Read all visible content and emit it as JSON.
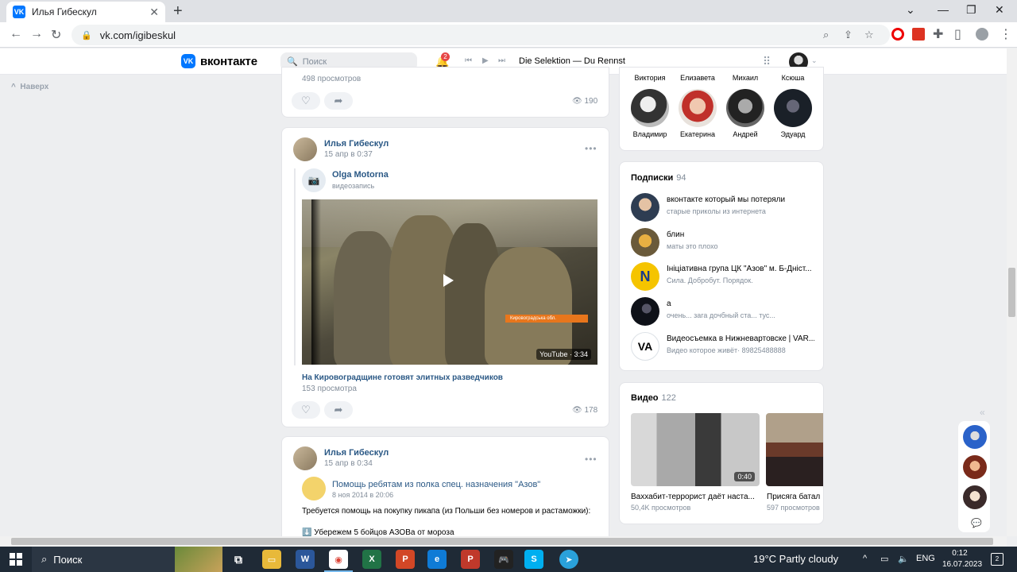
{
  "browser": {
    "tab_title": "Илья Гибескул",
    "url": "vk.com/igibeskul"
  },
  "vk": {
    "logo_text": "вконтакте",
    "search_placeholder": "Поиск",
    "notifications_count": "2",
    "player_track": "Die Selektion — Du Rennst",
    "up_label": "Наверх"
  },
  "posts": [
    {
      "views_label": "498 просмотров",
      "view_count": "190"
    },
    {
      "author": "Илья Гибескул",
      "date": "15 апр в 0:37",
      "source_name": "Olga Motorna",
      "source_sub": "видеозапись",
      "video_title": "На Кировоградщине готовят элитных разведчиков",
      "video_views": "153 просмотра",
      "video_source": "YouTube · 3:34",
      "video_overlay": "Кировоградська обл.",
      "view_count": "178"
    },
    {
      "author": "Илья Гибескул",
      "date": "15 апр в 0:34",
      "source_name": "Помощь ребятам из полка спец. назначения \"Азов\"",
      "source_date": "8 ноя 2014 в 20:06",
      "text": "Требуется помощь на покупку пикапа (из Польши без номеров и растаможки):",
      "text2": "⬇️ Убережем 5 бойцов АЗОВа от мороза"
    }
  ],
  "friends": {
    "top_names": [
      "Виктория",
      "Елизавета",
      "Михаил",
      "Ксюша"
    ],
    "names": [
      "Владимир",
      "Екатерина",
      "Андрей",
      "Эдуард"
    ]
  },
  "subscriptions": {
    "title": "Подписки",
    "count": "94",
    "items": [
      {
        "name": "вконтакте который мы потеряли",
        "desc": "старые приколы из интернета"
      },
      {
        "name": "блин",
        "desc": "маты это плохо"
      },
      {
        "name": "Ініціативна група ЦК \"Азов\" м. Б-Дніст...",
        "desc": "Сила. Добробут. Порядок."
      },
      {
        "name": "а",
        "desc": "очень... зага дочбный ста... тус..."
      },
      {
        "name": "Видеосъемка в Нижневартовске | VAR...",
        "desc": "Видео которое живёт· 89825488888"
      }
    ]
  },
  "videos": {
    "title": "Видео",
    "count": "122",
    "items": [
      {
        "title": "Ваххабит-террорист даёт наста...",
        "views": "50,4K просмотров",
        "duration": "0:40"
      },
      {
        "title": "Присяга батал",
        "views": "597 просмотров"
      }
    ]
  },
  "taskbar": {
    "search_placeholder": "Поиск",
    "weather": "19°C  Partly cloudy",
    "lang": "ENG",
    "time": "0:12",
    "date": "16.07.2023",
    "notif_count": "2"
  },
  "colors": {
    "vk_blue": "#0077ff",
    "link": "#2a5885",
    "page_bg": "#edeef0"
  }
}
